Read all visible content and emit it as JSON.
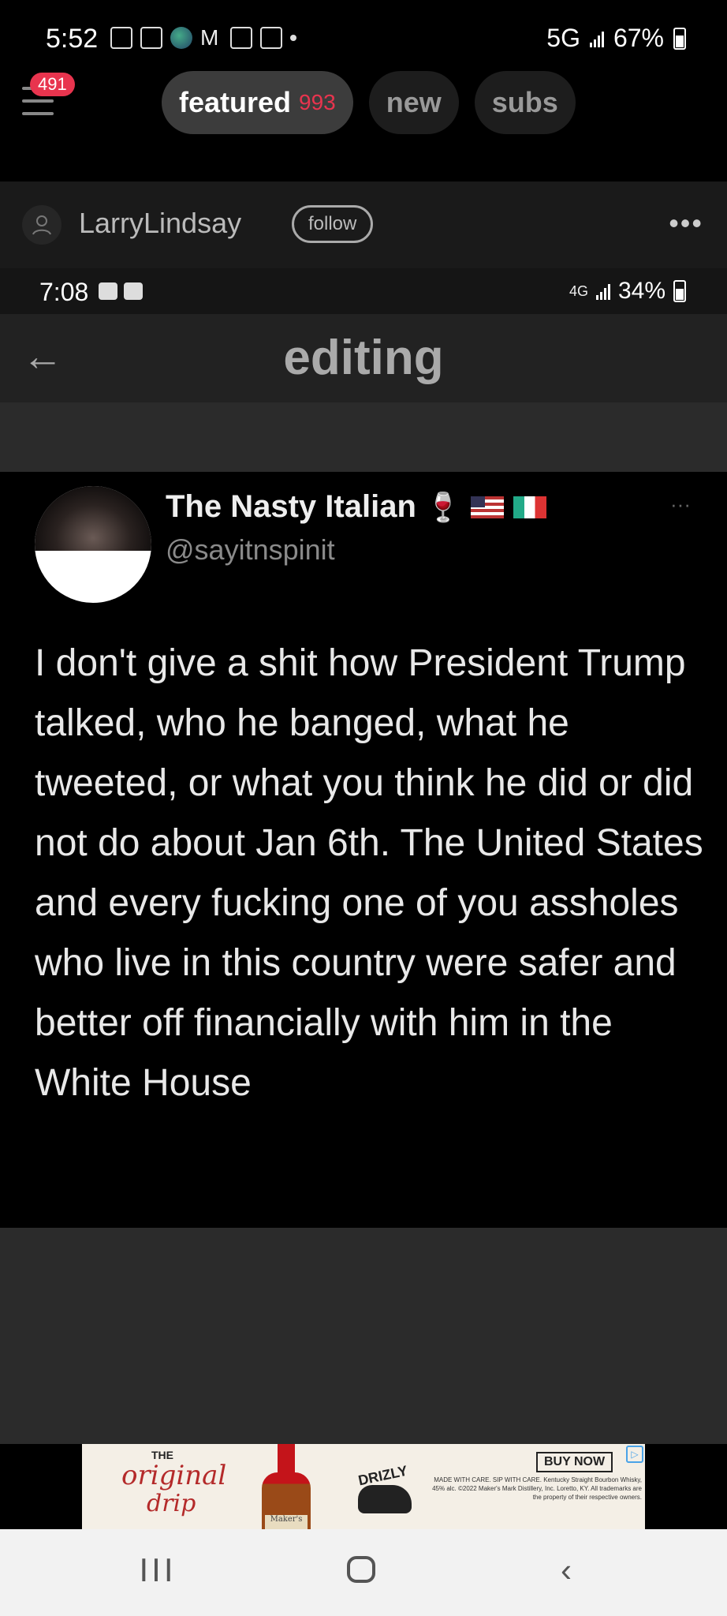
{
  "status_bar": {
    "time": "5:52",
    "network": "5G",
    "battery": "67%"
  },
  "nav": {
    "notification_count": "491",
    "tabs": [
      {
        "label": "featured",
        "count": "993"
      },
      {
        "label": "new"
      },
      {
        "label": "subs"
      }
    ]
  },
  "post": {
    "username": "LarryLindsay",
    "follow_label": "follow",
    "more_label": "•••"
  },
  "embedded": {
    "status": {
      "time": "7:08",
      "network": "4G",
      "battery": "34%"
    },
    "edit_title": "editing",
    "tweet": {
      "name": "The Nasty Italian",
      "handle": "@sayitnspinit",
      "more": "···",
      "text": "I don't give a shit how President Trump talked, who he banged, what he tweeted, or what you think he did or did not do about Jan 6th. The United States and every fucking one of you assholes who live in this country were safer and better off financially with him in the White House"
    }
  },
  "ad": {
    "line1": "THE",
    "line2": "original",
    "line3": "drip",
    "bottle_label": "Maker's",
    "brand": "DRIZLY",
    "cta": "BUY NOW",
    "fine_print": "MADE WITH CARE. SIP WITH CARE. Kentucky Straight Bourbon Whisky, 45% alc. ©2022 Maker's Mark Distillery, Inc. Loretto, KY. All trademarks are the property of their respective owners."
  },
  "system_nav": {
    "recents": "III",
    "back": "‹"
  },
  "colors": {
    "accent_badge": "#e8344e",
    "background": "#000000",
    "ad_red": "#b42a2a"
  }
}
